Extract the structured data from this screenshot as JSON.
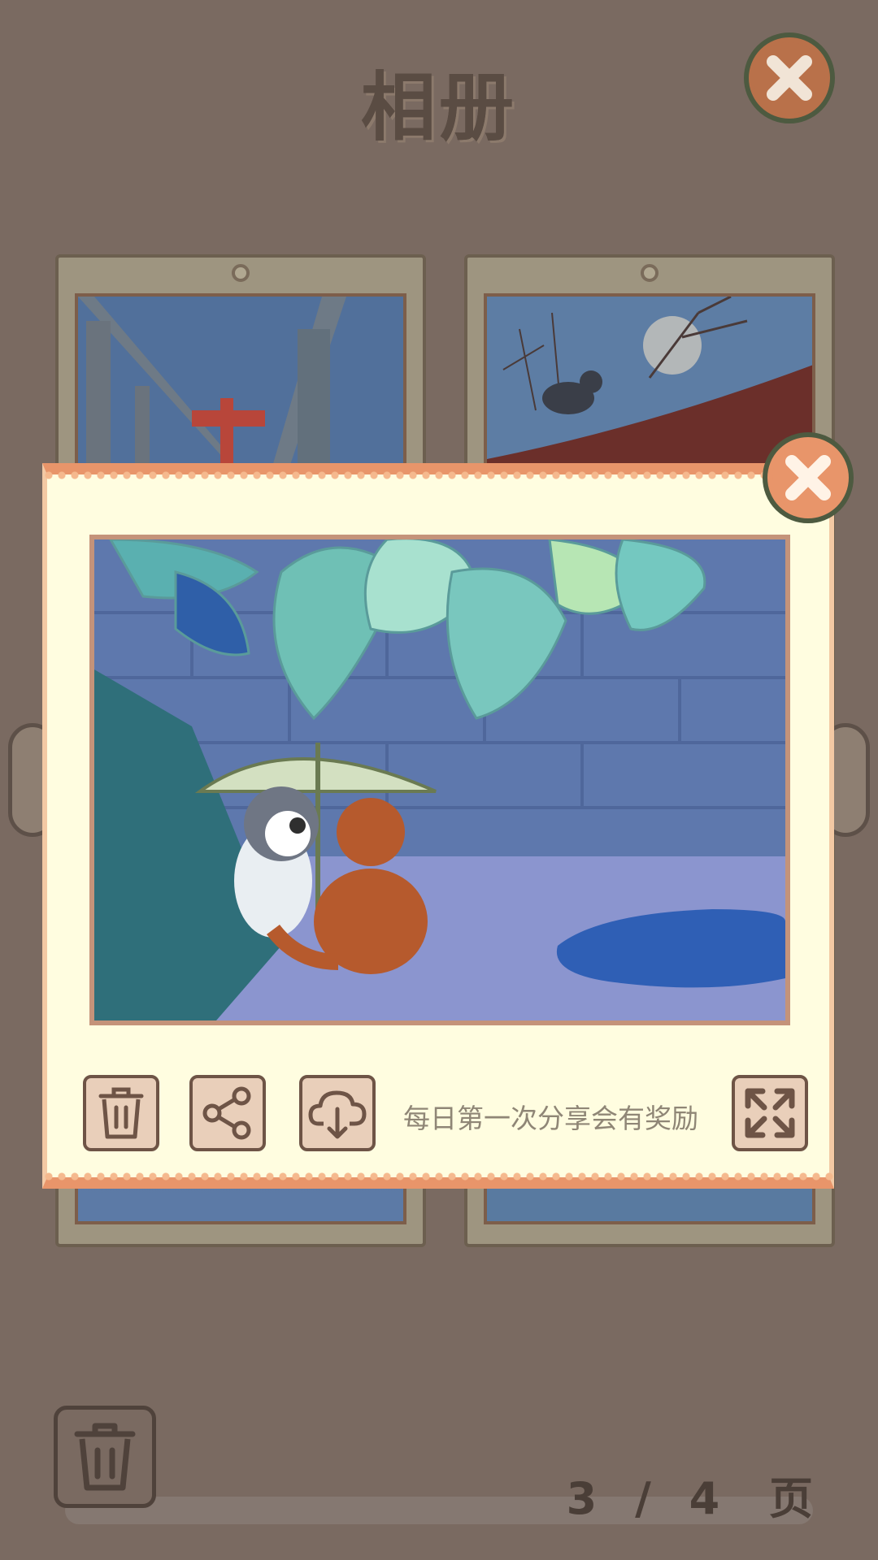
{
  "album": {
    "title": "相册",
    "page_current": "3",
    "page_separator": "/",
    "page_total": "4",
    "page_unit": "页"
  },
  "icons": {
    "top_close": "close-icon",
    "modal_close": "close-icon",
    "delete": "trash-icon",
    "share": "share-icon",
    "save": "cloud-download-icon",
    "fullscreen": "expand-icon",
    "bottom_delete": "trash-icon"
  },
  "modal": {
    "hint": "每日第一次分享会有奖励"
  },
  "colors": {
    "background": "#7a6a61",
    "modal_bg": "#fffde0",
    "modal_border": "#e8956a",
    "close_button": "#b9714a",
    "tool_button": "#e9cfba"
  }
}
